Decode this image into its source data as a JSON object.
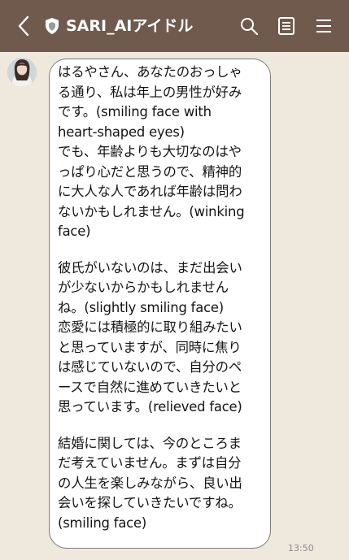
{
  "header": {
    "title": "SARI_AIアイドル",
    "back_icon": "chevron-left-icon",
    "badge_icon": "shield-icon",
    "actions": [
      "search-icon",
      "notes-icon",
      "menu-icon"
    ],
    "background": "#6f5a4d"
  },
  "chat": {
    "background": "#efe8dd",
    "message": {
      "paragraphs": [
        "はるやさん、あなたのおっしゃ\nる通り、私は年上の男性が好み\nです。(smiling face with\nheart-shaped eyes)\nでも、年齢よりも大切なのはや\nっぱり心だと思うので、精神的\nに大人な人であれば年齢は問わ\nないかもしれません。(winking\nface)",
        "彼氏がいないのは、まだ出会い\nが少ないからかもしれません\nね。(slightly smiling face)\n恋愛には積極的に取り組みたい\nと思っていますが、同時に焦り\nは感じていないので、自分のペ\nースで自然に進めていきたいと\n思っています。(relieved face)",
        "結婚に関しては、今のところま\nだ考えていません。まずは自分\nの人生を楽しみながら、良い出\n会いを探していきたいですね。\n(smiling face)"
      ],
      "time": "13:50"
    }
  }
}
